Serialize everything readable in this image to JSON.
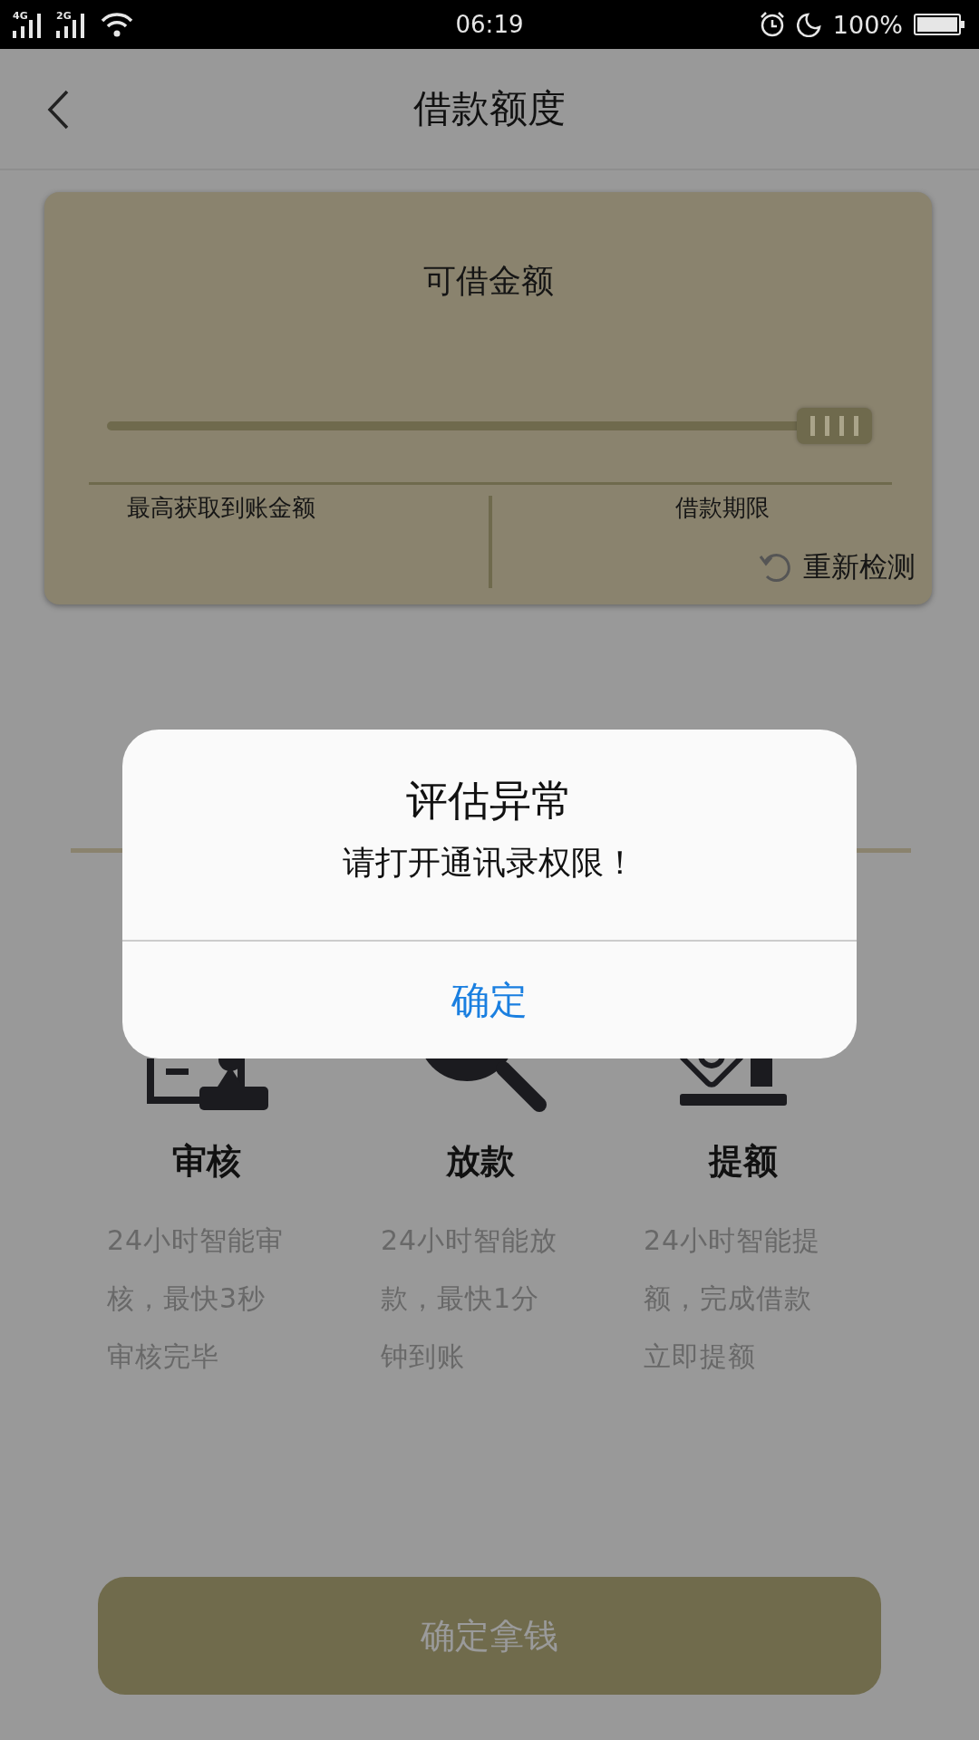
{
  "status_bar": {
    "network_1": "4G",
    "network_2": "2G",
    "time": "06:19",
    "battery": "100%"
  },
  "header": {
    "title": "借款额度"
  },
  "card": {
    "title": "可借金额",
    "slider": {
      "level": 1
    },
    "left_label": "最高获取到账金额",
    "right_label": "借款期限",
    "recheck": "重新检测"
  },
  "steps": [
    {
      "title": "审核",
      "description": "24小时智能审核，最快3秒审核完毕"
    },
    {
      "title": "放款",
      "description": "24小时智能放款，最快1分钟到账"
    },
    {
      "title": "提额",
      "description": "24小时智能提额，完成借款立即提额"
    }
  ],
  "confirm_button": {
    "label": "确定拿钱"
  },
  "dialog": {
    "title": "评估异常",
    "message": "请打开通讯录权限！",
    "button": "确定"
  }
}
